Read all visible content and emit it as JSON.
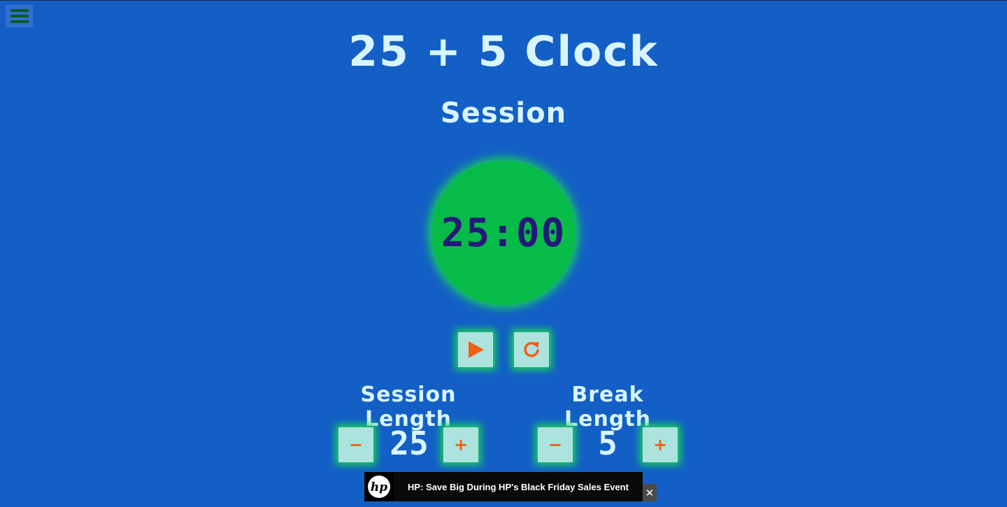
{
  "app": {
    "title": "25 + 5 Clock",
    "mode_label": "Session"
  },
  "timer": {
    "display": "25:00"
  },
  "controls": {
    "start_icon": "play-icon",
    "reset_icon": "reset-icon"
  },
  "session": {
    "label": "Session Length",
    "value": "25",
    "decrement": "−",
    "increment": "+"
  },
  "break": {
    "label": "Break Length",
    "value": "5",
    "decrement": "−",
    "increment": "+"
  },
  "ad": {
    "brand": "hp",
    "text": "HP: Save Big During HP's Black Friday Sales Event",
    "close": "✕"
  },
  "colors": {
    "background": "#135fc6",
    "clock_face": "#07bb49",
    "glow": "#19d556",
    "button_bg": "#ace3df",
    "accent_orange": "#f06012",
    "text_light": "#d8f5ff",
    "clock_digits": "#24197a"
  }
}
